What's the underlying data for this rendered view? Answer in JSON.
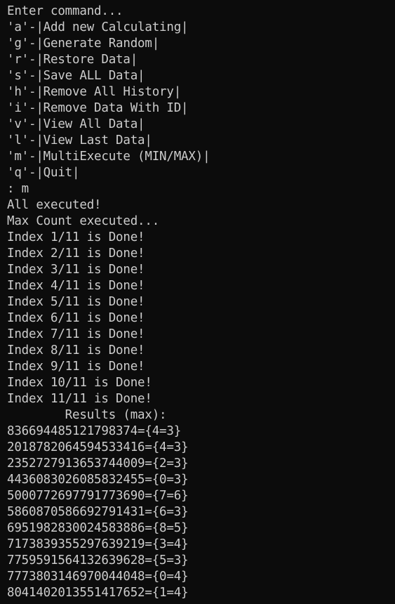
{
  "terminal": {
    "prompt": "Enter command...",
    "menu": [
      "'a'-|Add new Calculating|",
      "'g'-|Generate Random|",
      "'r'-|Restore Data|",
      "'s'-|Save ALL Data|",
      "'h'-|Remove All History|",
      "'i'-|Remove Data With ID|",
      "'v'-|View All Data|",
      "'l'-|View Last Data|",
      "'m'-|MultiExecute (MIN/MAX)|",
      "'q'-|Quit|"
    ],
    "input_line": ": m",
    "status": [
      "All executed!",
      "Max Count executed..."
    ],
    "progress": [
      "Index 1/11 is Done!",
      "Index 2/11 is Done!",
      "Index 3/11 is Done!",
      "Index 4/11 is Done!",
      "Index 5/11 is Done!",
      "Index 6/11 is Done!",
      "Index 7/11 is Done!",
      "Index 8/11 is Done!",
      "Index 9/11 is Done!",
      "Index 10/11 is Done!",
      "Index 11/11 is Done!"
    ],
    "results_header": "        Results (max):",
    "results": [
      "836694485121798374={4=3}",
      "2018782064594533416={4=3}",
      "2352727913653744009={2=3}",
      "4436083026085832455={0=3}",
      "5000772697791773690={7=6}",
      "5860870586692791431={6=3}",
      "6951982830024583886={8=5}",
      "7173839355297639219={3=4}",
      "7759591564132639628={5=3}",
      "7773803146970044048={0=4}",
      "8041402013551417652={1=4}"
    ]
  }
}
